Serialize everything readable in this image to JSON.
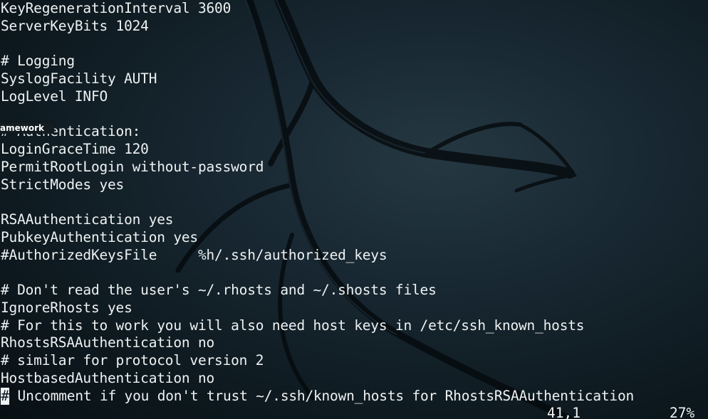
{
  "editor": {
    "lines": [
      "KeyRegenerationInterval 3600",
      "ServerKeyBits 1024",
      "",
      "# Logging",
      "SyslogFacility AUTH",
      "LogLevel INFO",
      "",
      "# Authentication:",
      "LoginGraceTime 120",
      "PermitRootLogin without-password",
      "StrictModes yes",
      "",
      "RSAAuthentication yes",
      "PubkeyAuthentication yes",
      "#AuthorizedKeysFile     %h/.ssh/authorized_keys",
      "",
      "# Don't read the user's ~/.rhosts and ~/.shosts files",
      "IgnoreRhosts yes",
      "# For this to work you will also need host keys in /etc/ssh_known_hosts",
      "RhostsRSAAuthentication no",
      "# similar for protocol version 2",
      "HostbasedAuthentication no"
    ],
    "cursor_line": {
      "cursor_char": "#",
      "rest": " Uncomment if you don't trust ~/.ssh/known_hosts for RhostsRSAAuthentication"
    }
  },
  "overlay": {
    "label": "amework"
  },
  "status": {
    "position": "41,1",
    "percent": "27%"
  }
}
